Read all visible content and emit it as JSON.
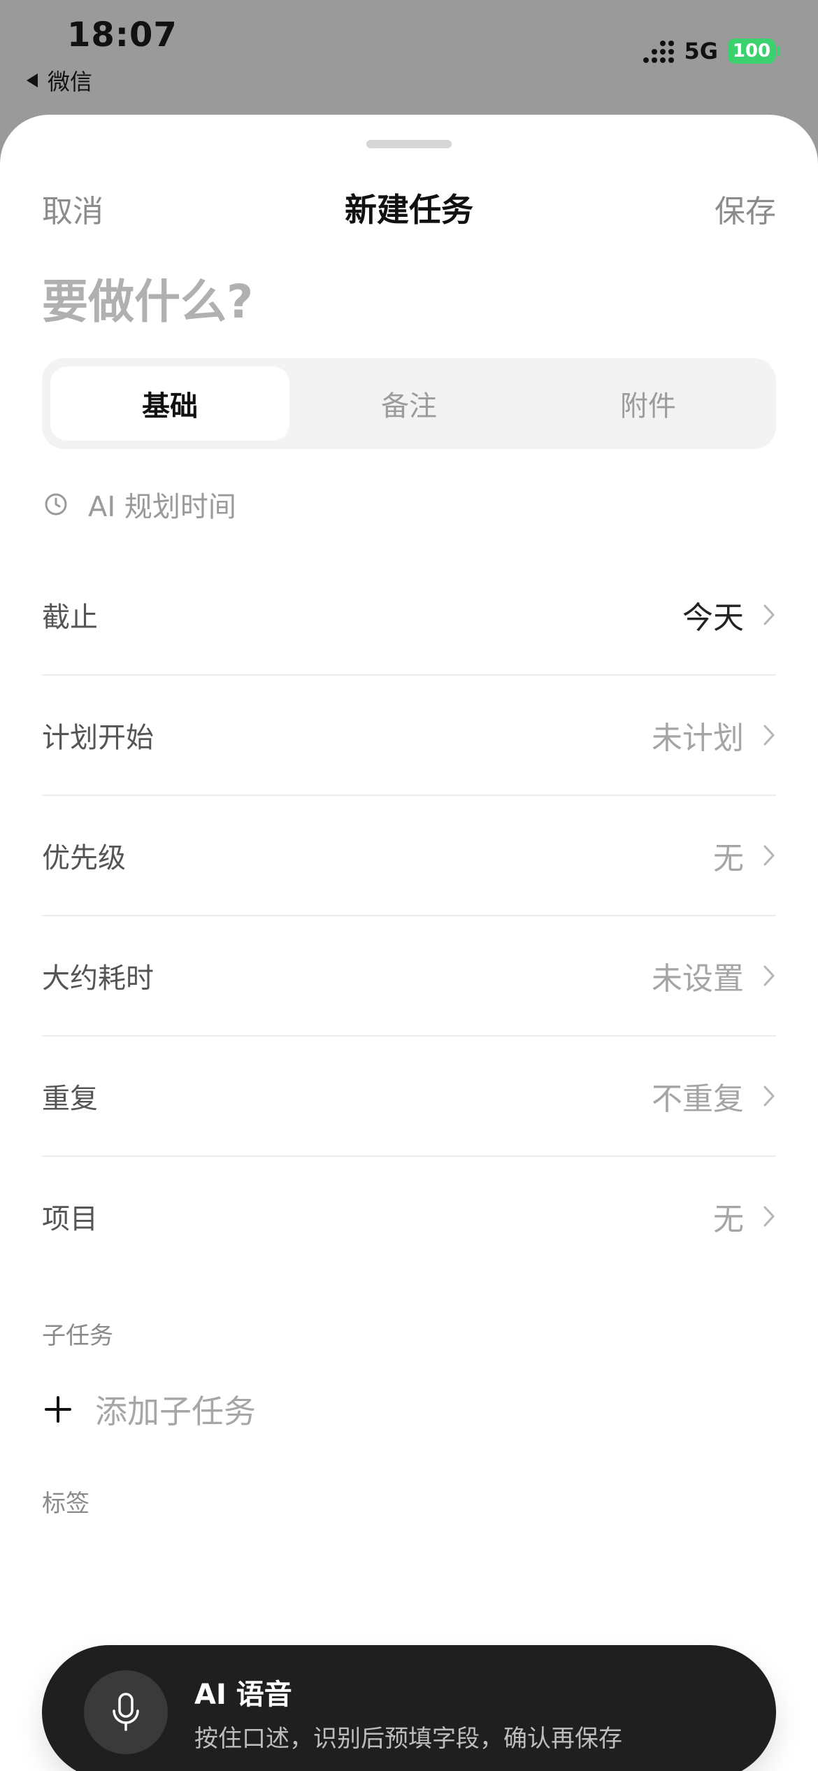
{
  "status_bar": {
    "time": "18:07",
    "back_app": "微信",
    "network": "5G",
    "battery": "100"
  },
  "nav": {
    "cancel": "取消",
    "title": "新建任务",
    "save": "保存"
  },
  "task": {
    "title_placeholder": "要做什么?",
    "title_value": ""
  },
  "tabs": [
    {
      "label": "基础",
      "active": true
    },
    {
      "label": "备注",
      "active": false
    },
    {
      "label": "附件",
      "active": false
    }
  ],
  "ai_plan": {
    "label": "AI 规划时间",
    "icon": "clock-icon"
  },
  "fields": [
    {
      "label": "截止",
      "value": "今天"
    },
    {
      "label": "计划开始",
      "value": "未计划"
    },
    {
      "label": "优先级",
      "value": "无"
    },
    {
      "label": "大约耗时",
      "value": "未设置"
    },
    {
      "label": "重复",
      "value": "不重复"
    },
    {
      "label": "项目",
      "value": "无"
    }
  ],
  "subtasks": {
    "section_label": "子任务",
    "add_label": "添加子任务"
  },
  "tags": {
    "section_label": "标签"
  },
  "voice": {
    "title": "AI 语音",
    "subtitle": "按住口述，识别后预填字段，确认再保存",
    "icon": "microphone-icon"
  },
  "colors": {
    "battery_green": "#3bd16f",
    "pill_background": "#1f1f1f",
    "muted_text": "#a5a5a5"
  }
}
